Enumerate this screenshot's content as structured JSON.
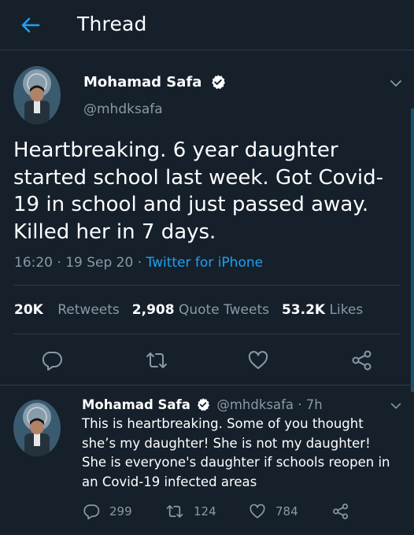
{
  "header": {
    "title": "Thread",
    "back_icon": "arrow-left-icon",
    "accent": "#1da1f2"
  },
  "main_tweet": {
    "author_name": "Mohamad Safa",
    "handle": "@mhdksafa",
    "verified": true,
    "text": "Heartbreaking. 6 year daughter started school last week. Got Covid-19 in school and just passed away. Killed her in 7 days.",
    "time": "16:20 · 19 Sep 20 · ",
    "source": "Twitter for iPhone",
    "stats": {
      "retweets_count": "20K",
      "retweets_label": "Retweets",
      "quotes_count": "2,908",
      "quotes_label": "Quote Tweets",
      "likes_count": "53.2K",
      "likes_label": "Likes"
    }
  },
  "reply_tweet": {
    "author_name": "Mohamad Safa",
    "handle_time": "@mhdksafa · 7h",
    "verified": true,
    "text": "This is heartbreaking. Some of you thought she’s my daughter! She is not my daughter! She is everyone's daughter if schools reopen in an Covid-19 infected areas",
    "replies": "299",
    "retweets": "124",
    "likes": "784"
  },
  "colors": {
    "background": "#15202b",
    "secondary_text": "#8899a6",
    "divider": "#2f3b46",
    "verified": "#ffffff"
  }
}
